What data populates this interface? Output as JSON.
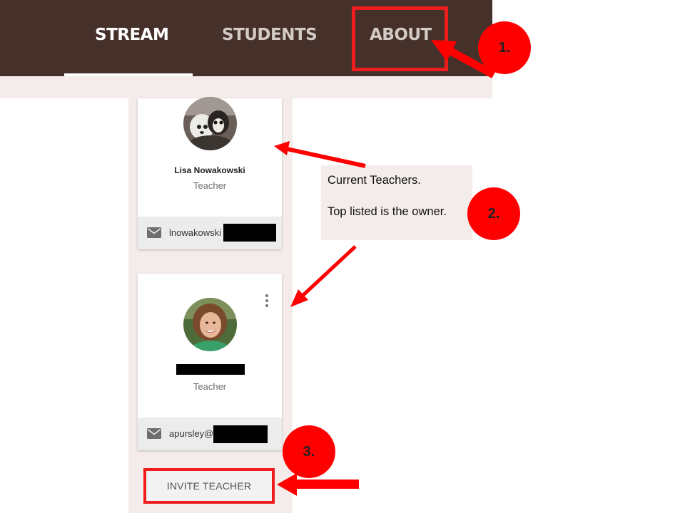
{
  "nav": {
    "tabs": [
      {
        "label": "STREAM",
        "active": true
      },
      {
        "label": "STUDENTS",
        "active": false
      },
      {
        "label": "ABOUT",
        "active": false
      }
    ]
  },
  "teachers": [
    {
      "name": "Lisa Nowakowski",
      "role": "Teacher",
      "email_visible": "lnowakowski",
      "email_redacted": true,
      "owner": true
    },
    {
      "name": "",
      "name_redacted": true,
      "role": "Teacher",
      "email_visible": "apursley@",
      "email_redacted": true,
      "has_menu": true
    }
  ],
  "invite_button": {
    "label": "INVITE TEACHER"
  },
  "annotations": {
    "callout_lines": [
      "Current Teachers.",
      "Top listed is the owner."
    ],
    "steps": [
      "1.",
      "2.",
      "3."
    ],
    "highlight_color": "#ee1c1c"
  },
  "colors": {
    "header_bg": "#46302a",
    "page_bg": "#f4ecea",
    "card_bg": "#ffffff",
    "step_badge": "#ff0000"
  },
  "icons": {
    "mail": "mail-icon",
    "menu": "more-vert-icon"
  }
}
